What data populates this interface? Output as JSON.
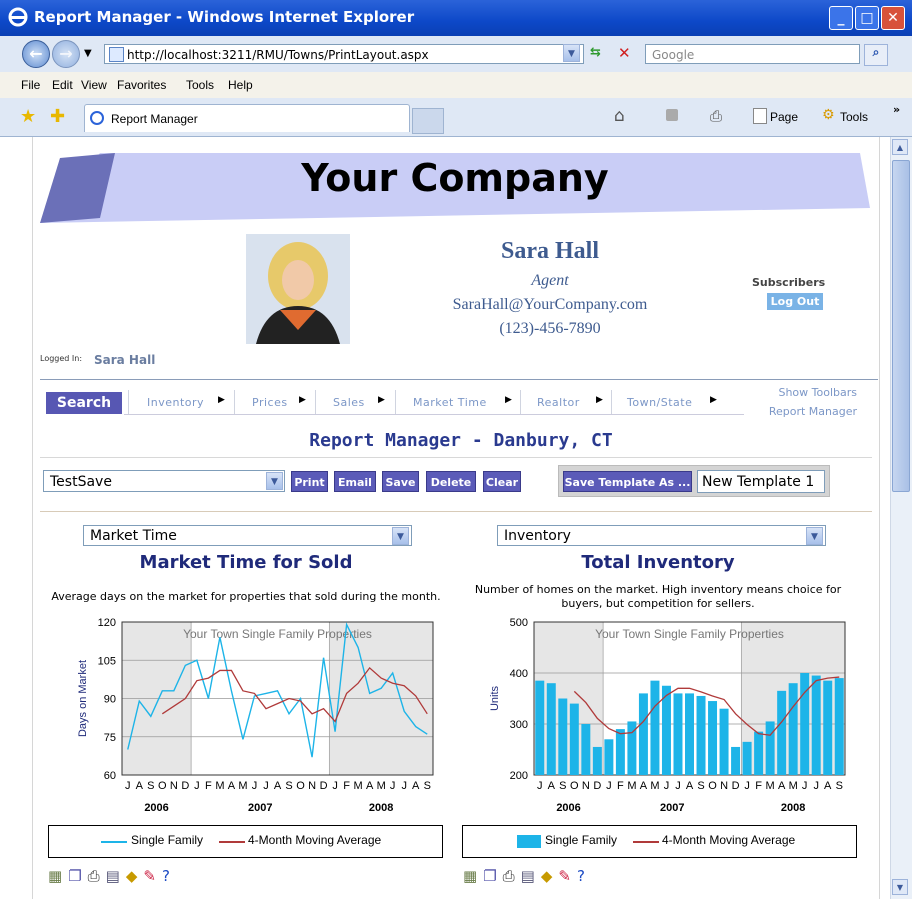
{
  "window": {
    "title": "Report Manager - Windows Internet Explorer",
    "url": "http://localhost:3211/RMU/Towns/PrintLayout.aspx",
    "search_placeholder": "Google",
    "menu": [
      "File",
      "Edit",
      "View",
      "Favorites",
      "Tools",
      "Help"
    ],
    "tab_label": "Report Manager",
    "command_page": "Page",
    "command_tools": "Tools"
  },
  "header": {
    "company": "Your Company",
    "agent_name": "Sara Hall",
    "agent_title": "Agent",
    "agent_email": "SaraHall@YourCompany.com",
    "agent_phone": "(123)-456-7890",
    "subscribers_label": "Subscribers",
    "logout_label": "Log Out",
    "logged_in_label": "Logged In:",
    "logged_in_user": "Sara Hall"
  },
  "nav": {
    "search_label": "Search",
    "items": [
      "Inventory",
      "Prices",
      "Sales",
      "Market Time",
      "Realtor",
      "Town/State"
    ],
    "show_toolbars": "Show Toolbars",
    "report_manager": "Report Manager"
  },
  "report": {
    "title": "Report Manager - Danbury, CT",
    "template_selected": "TestSave",
    "buttons": {
      "print": "Print",
      "email": "Email",
      "save": "Save",
      "delete": "Delete",
      "clear": "Clear"
    },
    "save_template_label": "Save Template As ...",
    "template_name": "New Template 1"
  },
  "charts": [
    {
      "select_value": "Market Time",
      "title": "Market Time for Sold",
      "description": "Average days on the market for properties that sold during the month.",
      "watermark": "Your Town Single Family Properties",
      "legend_series": "Single Family",
      "legend_avg": "4-Month Moving Average"
    },
    {
      "select_value": "Inventory",
      "title": "Total Inventory",
      "description_line1": "Number of homes on the market. High inventory means choice for",
      "description_line2": "buyers, but competition for sellers.",
      "watermark": "Your Town Single Family Properties",
      "legend_series": "Single Family",
      "legend_avg": "4-Month Moving Average"
    }
  ],
  "colors": {
    "series": "#1db4e8",
    "moving_average": "#b03a3a",
    "button": "#5b5bb8",
    "title_blue": "#1f2a7a",
    "plot_band": "#e6e6e6"
  },
  "chart_data": [
    {
      "type": "line",
      "title": "Market Time for Sold",
      "ylabel": "Days on Market",
      "xlabel": "",
      "x": [
        "J",
        "A",
        "S",
        "O",
        "N",
        "D",
        "J",
        "F",
        "M",
        "A",
        "M",
        "J",
        "J",
        "A",
        "S",
        "O",
        "N",
        "D",
        "J",
        "F",
        "M",
        "A",
        "M",
        "J",
        "J",
        "A",
        "S"
      ],
      "year_labels": [
        "2006",
        "2007",
        "2008"
      ],
      "ylim": [
        60,
        120
      ],
      "yticks": [
        60,
        75,
        90,
        105,
        120
      ],
      "grid": true,
      "legend": "bottom",
      "series": [
        {
          "name": "Single Family",
          "values": [
            70,
            89,
            83,
            93,
            93,
            103,
            105,
            90,
            114,
            93,
            74,
            91,
            92,
            93,
            84,
            90,
            67,
            106,
            77,
            119,
            110,
            92,
            94,
            100,
            85,
            79,
            76
          ]
        },
        {
          "name": "4-Month Moving Average",
          "values": [
            null,
            null,
            null,
            84,
            87,
            90,
            97,
            98,
            101,
            101,
            93,
            92,
            86,
            88,
            90,
            89,
            84,
            86,
            81,
            92,
            96,
            102,
            98,
            96,
            95,
            91,
            84
          ]
        }
      ]
    },
    {
      "type": "bar",
      "title": "Total Inventory",
      "ylabel": "Units",
      "xlabel": "",
      "categories": [
        "J",
        "A",
        "S",
        "O",
        "N",
        "D",
        "J",
        "F",
        "M",
        "A",
        "M",
        "J",
        "J",
        "A",
        "S",
        "O",
        "N",
        "D",
        "J",
        "F",
        "M",
        "A",
        "M",
        "J",
        "J",
        "A",
        "S"
      ],
      "year_labels": [
        "2006",
        "2007",
        "2008"
      ],
      "ylim": [
        200,
        500
      ],
      "yticks": [
        200,
        300,
        400,
        500
      ],
      "grid": true,
      "legend": "bottom",
      "series": [
        {
          "name": "Single Family",
          "values": [
            385,
            380,
            350,
            340,
            300,
            255,
            270,
            290,
            305,
            360,
            385,
            375,
            360,
            360,
            355,
            345,
            330,
            255,
            265,
            285,
            305,
            365,
            380,
            400,
            395,
            385,
            390
          ]
        },
        {
          "name": "4-Month Moving Average",
          "values": [
            null,
            null,
            null,
            364,
            342,
            311,
            291,
            281,
            283,
            305,
            335,
            356,
            370,
            370,
            363,
            355,
            348,
            320,
            299,
            281,
            278,
            304,
            334,
            362,
            385,
            390,
            392
          ]
        }
      ]
    }
  ]
}
